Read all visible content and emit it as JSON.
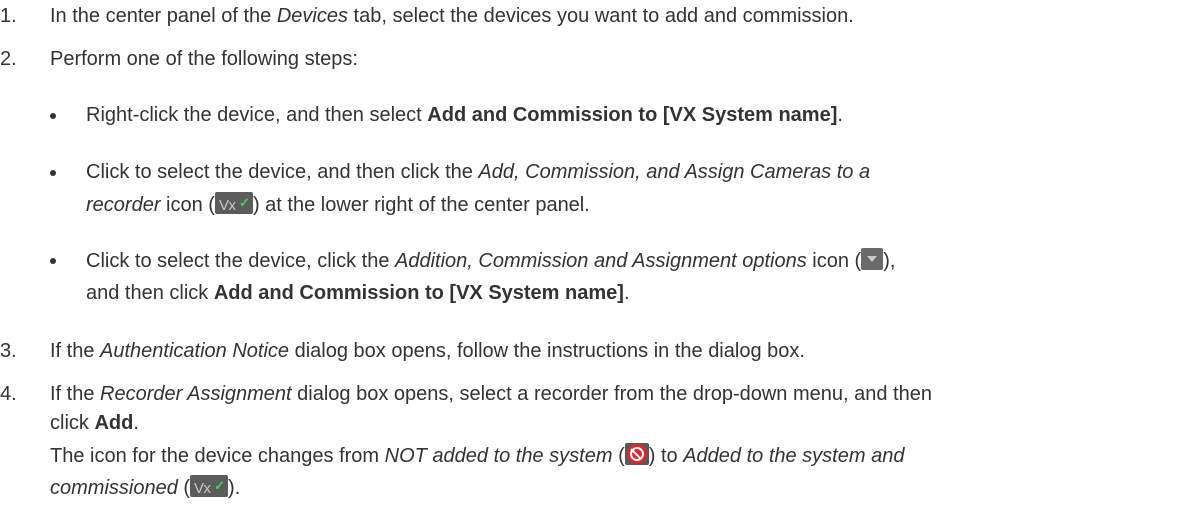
{
  "steps": [
    {
      "number": "1.",
      "parts": [
        "In the center panel of the ",
        "Devices",
        " tab, select the devices you want to add and commission."
      ]
    },
    {
      "number": "2.",
      "text": "Perform one of the following steps:",
      "bullets": [
        {
          "parts": [
            "Right-click the device, and then select ",
            "Add and Commission to [VX System name]",
            "."
          ]
        },
        {
          "line1": [
            "Click to select the device, and then click the ",
            "Add, Commission, and Assign Cameras to a"
          ],
          "line2": [
            "recorder",
            " icon (",
            ") at the lower right of the center panel."
          ],
          "icon": "vx-commission-icon"
        },
        {
          "line1": [
            "Click to select the device, click the ",
            "Addition, Commission and Assignment options",
            " icon (",
            "),"
          ],
          "line2": [
            "and then click ",
            "Add and Commission to [VX System name]",
            "."
          ],
          "icon": "dropdown-options-icon"
        }
      ]
    },
    {
      "number": "3.",
      "parts": [
        "If the ",
        "Authentication Notice",
        " dialog box opens, follow the instructions in the dialog box."
      ]
    },
    {
      "number": "4.",
      "line1": [
        "If the ",
        "Recorder Assignment",
        " dialog box opens, select a recorder from the drop-down menu, and then"
      ],
      "line2": [
        "click ",
        "Add",
        "."
      ],
      "line3": [
        "The icon for the device changes from ",
        "NOT added to the system",
        " (",
        ") to ",
        "Added to the system and"
      ],
      "line4": [
        "commissioned",
        " (",
        ")."
      ]
    }
  ],
  "icons": {
    "vx_label": "Vx",
    "check": "✓"
  }
}
